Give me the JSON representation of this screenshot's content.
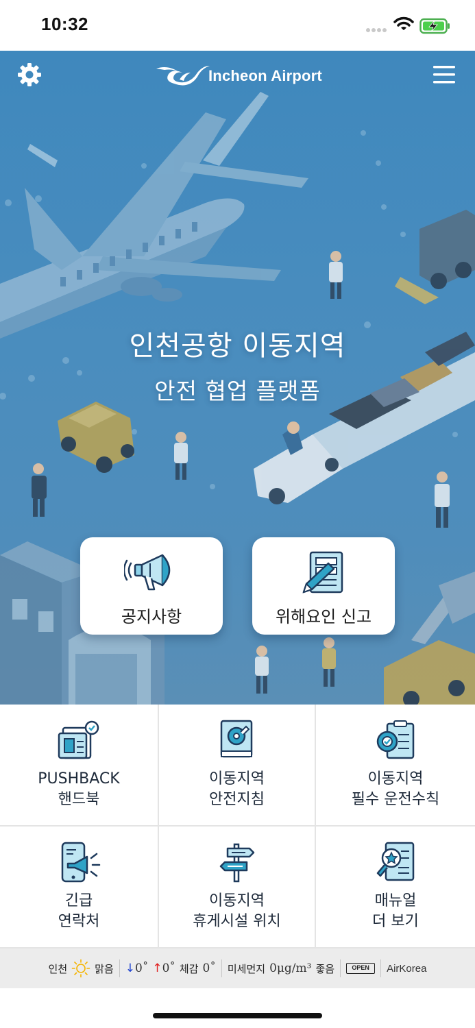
{
  "status_bar": {
    "time": "10:32"
  },
  "header": {
    "logo_text": "Incheon Airport",
    "settings_icon": "gear-icon",
    "menu_icon": "hamburger-icon"
  },
  "hero": {
    "title": "인천공항 이동지역",
    "subtitle": "안전 협업 플랫폼",
    "cards": [
      {
        "label": "공지사항",
        "icon": "megaphone-icon"
      },
      {
        "label": "위해요인 신고",
        "icon": "report-pen-icon"
      }
    ]
  },
  "grid": {
    "items": [
      {
        "line1": "PUSHBACK",
        "line2": "핸드북",
        "icon": "handbook-icon"
      },
      {
        "line1": "이동지역",
        "line2": "안전지침",
        "icon": "safety-guide-icon"
      },
      {
        "line1": "이동지역",
        "line2": "필수 운전수칙",
        "icon": "driving-rules-icon"
      },
      {
        "line1": "긴급",
        "line2": "연락처",
        "icon": "emergency-phone-icon"
      },
      {
        "line1": "이동지역",
        "line2": "휴게시설 위치",
        "icon": "signpost-icon"
      },
      {
        "line1": "매뉴얼",
        "line2": "더 보기",
        "icon": "manual-search-icon"
      }
    ]
  },
  "weather": {
    "city": "인천",
    "condition": "맑음",
    "low": "0˚",
    "high": "0˚",
    "feels_label": "체감",
    "feels": "0˚",
    "dust_label": "미세먼지",
    "dust_value": "0μg/m³",
    "dust_status": "좋음",
    "open_badge": "OPEN",
    "source": "AirKorea",
    "colors": {
      "low_arrow": "#1a3fd0",
      "high_arrow": "#e02020",
      "sun": "#f5b400"
    }
  },
  "colors": {
    "hero_blue": "#4a8dbe",
    "icon_teal": "#2fa3c7",
    "icon_navy": "#1e3a5c"
  }
}
